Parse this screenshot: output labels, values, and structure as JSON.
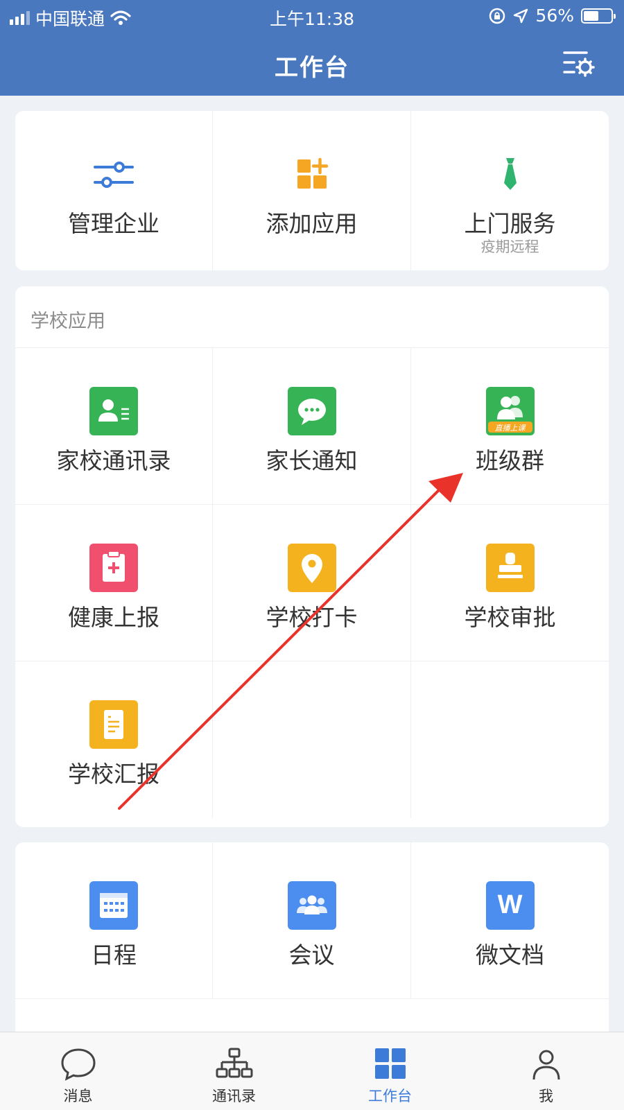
{
  "status_bar": {
    "carrier": "中国联通",
    "time": "上午11:38",
    "battery_text": "56%",
    "battery_level": 0.56
  },
  "header": {
    "title": "工作台",
    "settings_icon": "list-settings-icon"
  },
  "quick_actions": [
    {
      "label": "管理企业",
      "sub": "",
      "icon": "sliders-icon",
      "color": "#3d7bd9"
    },
    {
      "label": "添加应用",
      "sub": "",
      "icon": "add-grid-icon",
      "color": "#f5a623"
    },
    {
      "label": "上门服务",
      "sub": "疫期远程",
      "icon": "tie-icon",
      "color": "#2fb36e"
    }
  ],
  "school_apps": {
    "title": "学校应用",
    "items": [
      {
        "label": "家校通讯录",
        "icon": "contact-card-icon",
        "color": "#36b354"
      },
      {
        "label": "家长通知",
        "icon": "chat-bubble-icon",
        "color": "#36b354"
      },
      {
        "label": "班级群",
        "icon": "group-live-icon",
        "color": "#36b354",
        "badge": "直播上课"
      },
      {
        "label": "健康上报",
        "icon": "clipboard-plus-icon",
        "color": "#f0506e"
      },
      {
        "label": "学校打卡",
        "icon": "location-pin-icon",
        "color": "#f5b21f"
      },
      {
        "label": "学校审批",
        "icon": "stamp-icon",
        "color": "#f5b21f"
      },
      {
        "label": "学校汇报",
        "icon": "document-icon",
        "color": "#f5b21f"
      }
    ]
  },
  "office_apps": [
    {
      "label": "日程",
      "icon": "calendar-icon",
      "color": "#4c8ef0"
    },
    {
      "label": "会议",
      "icon": "meeting-icon",
      "color": "#4c8ef0"
    },
    {
      "label": "微文档",
      "icon": "word-doc-icon",
      "color": "#4c8ef0",
      "glyph": "W"
    }
  ],
  "tabs": [
    {
      "label": "消息",
      "icon": "message-icon",
      "active": false
    },
    {
      "label": "通讯录",
      "icon": "org-chart-icon",
      "active": false
    },
    {
      "label": "工作台",
      "icon": "workbench-grid-icon",
      "active": true
    },
    {
      "label": "我",
      "icon": "profile-icon",
      "active": false
    }
  ],
  "colors": {
    "header": "#4a78bf",
    "accent": "#3d7bd9",
    "annotation_arrow": "#e8322a"
  }
}
